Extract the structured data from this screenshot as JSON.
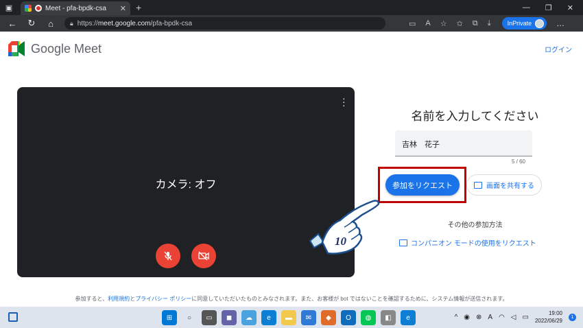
{
  "browser": {
    "tab_title": "Meet - pfa-bpdk-csa",
    "url_prefix": "https://",
    "url_host": "meet.google.com",
    "url_path": "/pfa-bpdk-csa",
    "inprivate_label": "InPrivate"
  },
  "header": {
    "logo_text": "Google Meet",
    "login_link": "ログイン"
  },
  "preview": {
    "camera_status": "カメラ: オフ"
  },
  "join": {
    "title": "名前を入力してください",
    "name_value": "吉林　花子",
    "char_counter": "5 / 60",
    "request_button": "参加をリクエスト",
    "share_button": "画面を共有する",
    "other_methods": "その他の参加方法",
    "companion_link": "コンパニオン モードの使用をリクエスト"
  },
  "annotation": {
    "hand_number": "10",
    "highlight_color": "#c00000"
  },
  "footer": {
    "text_before": "参加すると、",
    "terms_link": "利用規約",
    "and": "と",
    "privacy_link": "プライバシー ポリシー",
    "text_after": "に同意していただいたものとみなされます。また、お客様が bot ではないことを確認するために、システム情報が送信されます。"
  },
  "taskbar": {
    "time": "19:00",
    "date": "2022/06/29",
    "notification_count": "1"
  },
  "colors": {
    "accent": "#1a73e8",
    "danger": "#ea4335",
    "preview_bg": "#202124"
  }
}
